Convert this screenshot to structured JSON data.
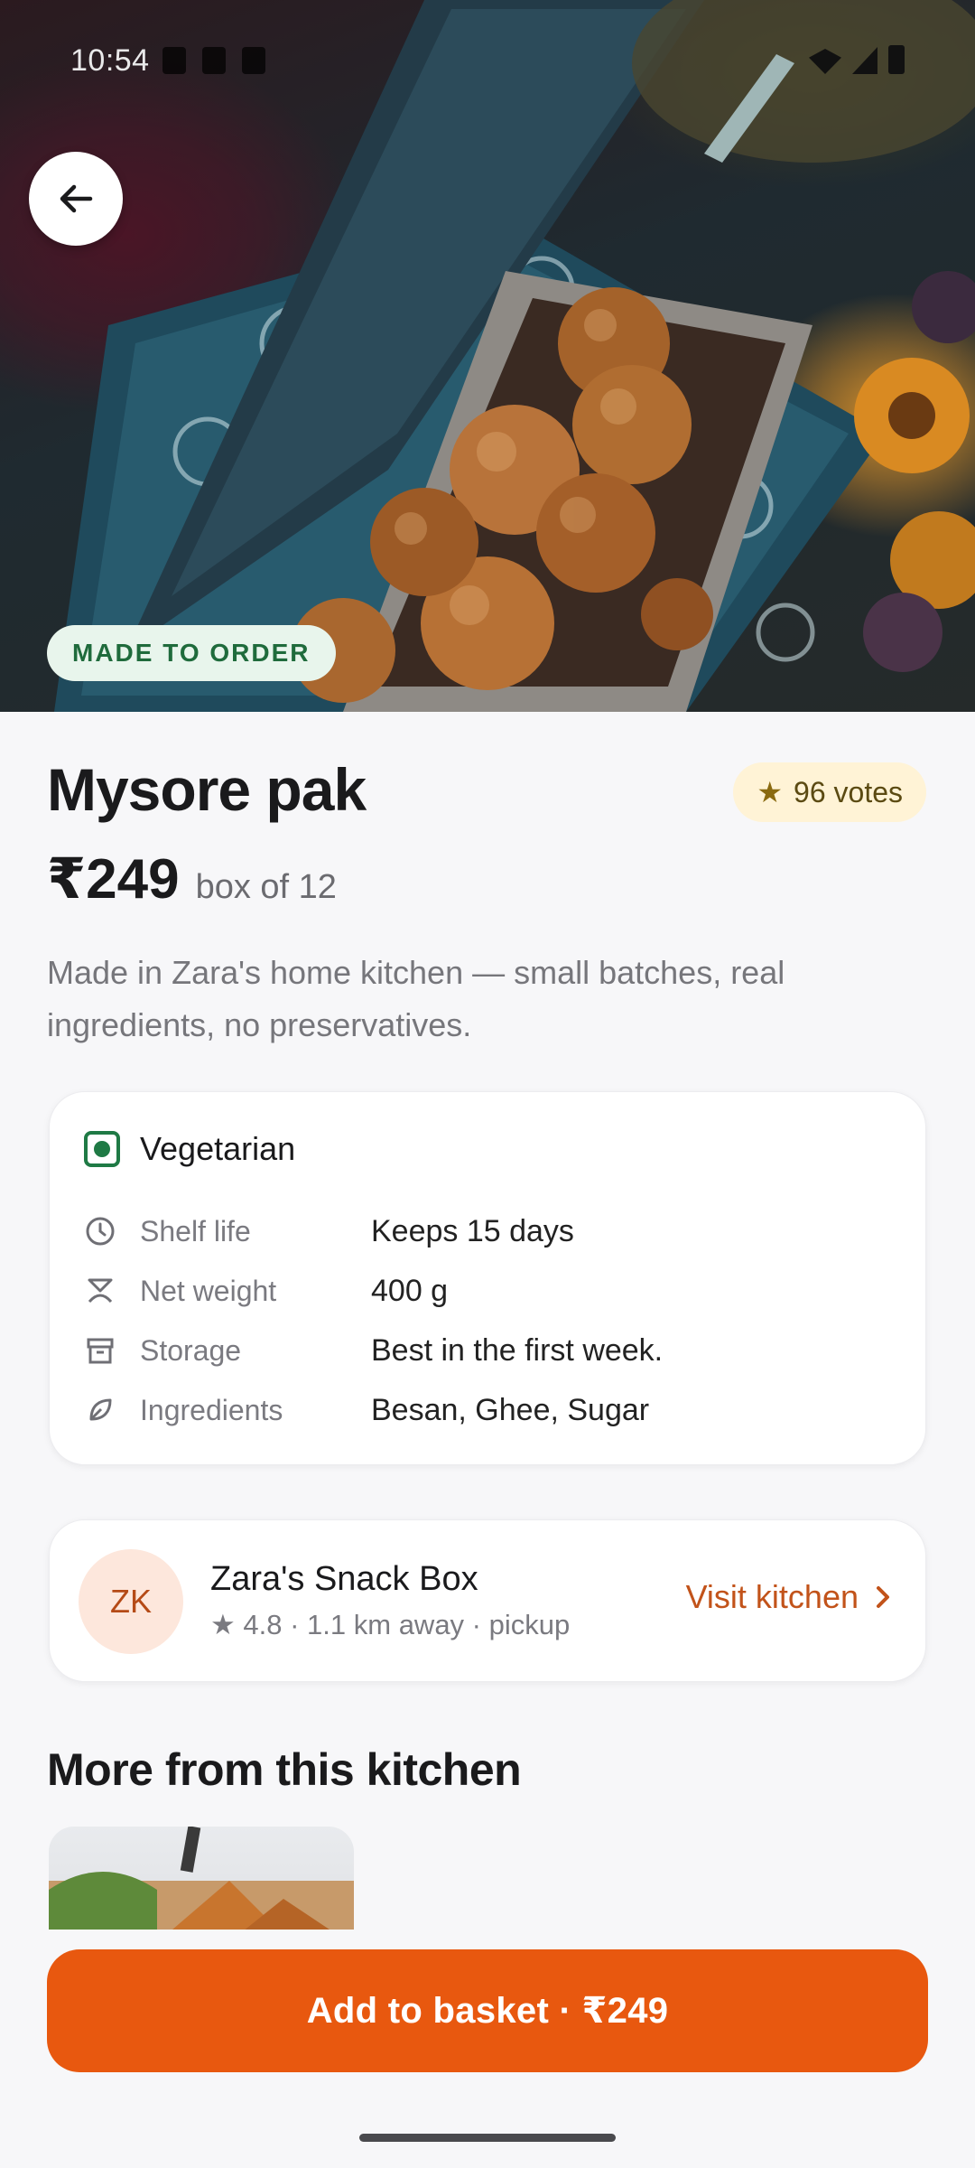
{
  "status_bar": {
    "time": "10:54"
  },
  "hero": {
    "badge": "MADE TO ORDER"
  },
  "product": {
    "title": "Mysore pak",
    "votes": "96 votes",
    "price": "₹249",
    "unit": "box of 12",
    "description": "Made in Zara's home kitchen — small batches, real ingredients, no preservatives."
  },
  "info": {
    "diet": "Vegetarian",
    "specs": [
      {
        "icon": "clock-icon",
        "label": "Shelf life",
        "value": "Keeps 15 days"
      },
      {
        "icon": "scale-icon",
        "label": "Net weight",
        "value": "400 g"
      },
      {
        "icon": "archive-box-icon",
        "label": "Storage",
        "value": "Best in the first week."
      },
      {
        "icon": "leaf-icon",
        "label": "Ingredients",
        "value": "Besan, Ghee, Sugar"
      }
    ]
  },
  "kitchen": {
    "initials": "ZK",
    "name": "Zara's Snack Box",
    "meta": "★ 4.8 · 1.1 km away · pickup",
    "visit_label": "Visit kitchen"
  },
  "more_section": {
    "title": "More from this kitchen"
  },
  "cta": {
    "label": "Add to basket · ₹249"
  },
  "colors": {
    "accent": "#e8580f",
    "veg_green": "#1f7a45",
    "vote_bg": "#fff3d6"
  }
}
